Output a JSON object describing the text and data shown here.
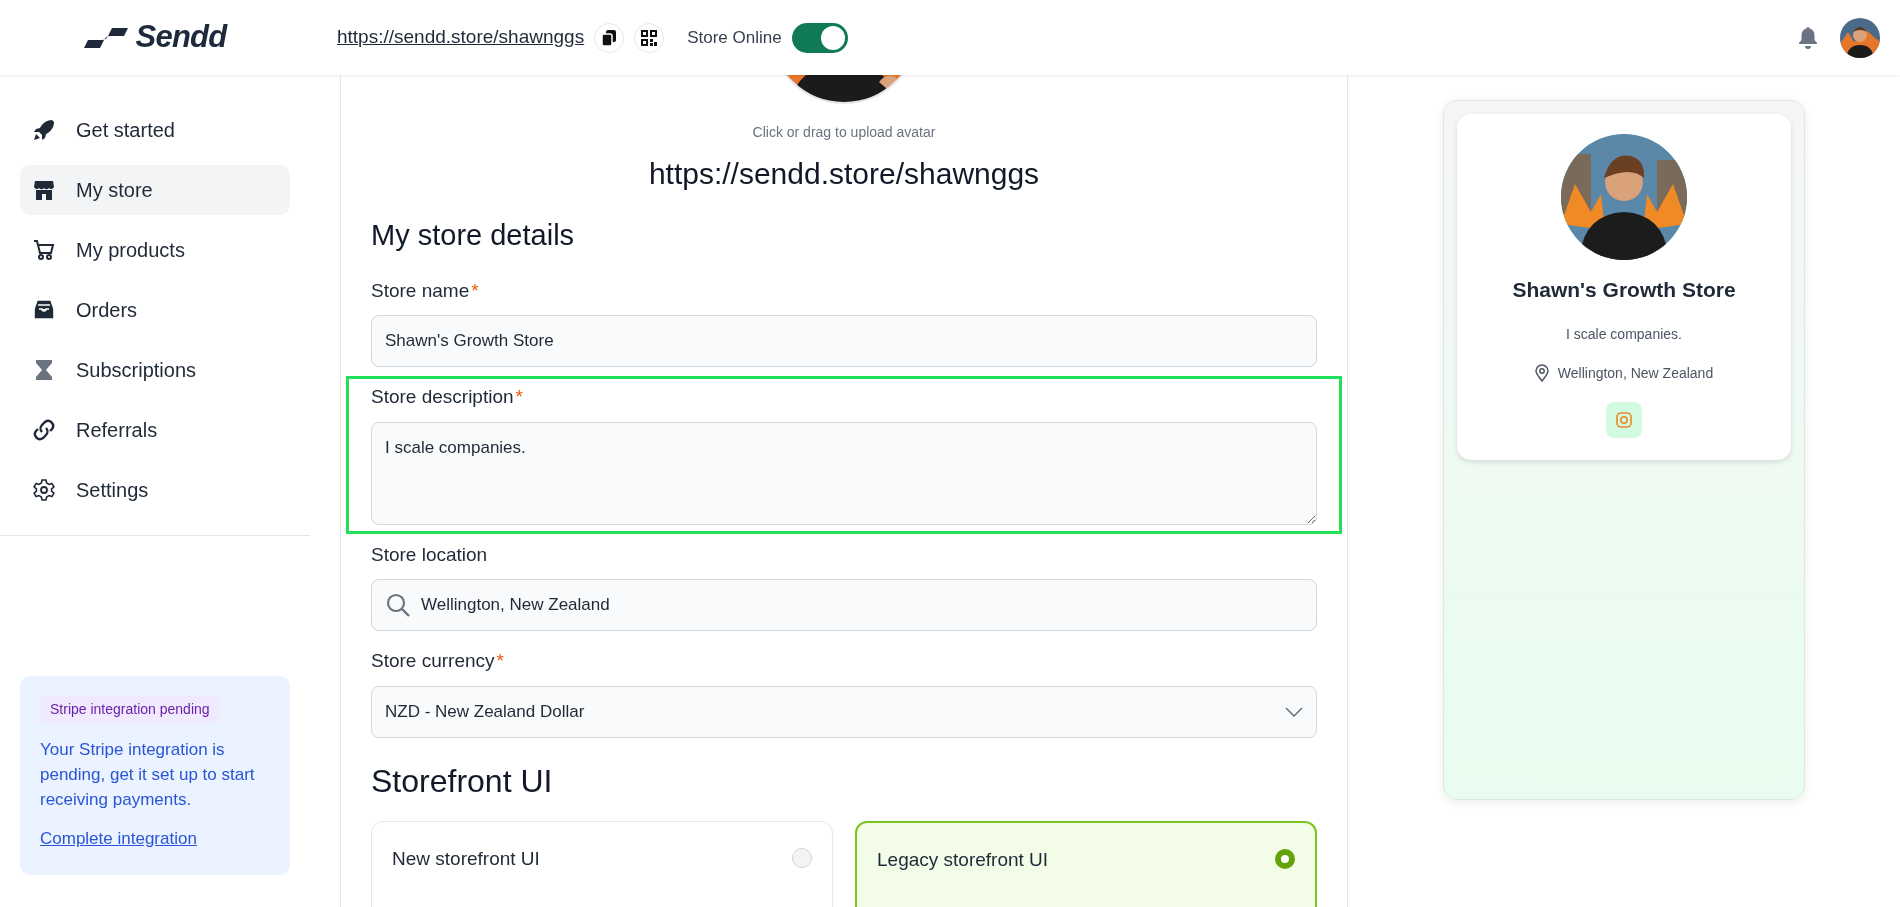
{
  "header": {
    "logo_text": "Sendd",
    "store_url": "https://sendd.store/shawnggs",
    "toggle": {
      "label": "Store Online",
      "on": true
    }
  },
  "sidebar": {
    "items": [
      {
        "label": "Get started",
        "selected": false
      },
      {
        "label": "My store",
        "selected": true
      },
      {
        "label": "My products",
        "selected": false
      },
      {
        "label": "Orders",
        "selected": false
      },
      {
        "label": "Subscriptions",
        "selected": false
      },
      {
        "label": "Referrals",
        "selected": false
      },
      {
        "label": "Settings",
        "selected": false
      }
    ],
    "notice": {
      "badge": "Stripe integration pending",
      "text": "Your Stripe integration is pending, get it set up to start receiving payments.",
      "link": "Complete integration"
    }
  },
  "editor": {
    "avatar_hint": "Click or drag to upload avatar",
    "store_url": "https://sendd.store/shawnggs",
    "section_title": "My store details",
    "fields": [
      {
        "kind": "text",
        "label": "Store name",
        "required_mark": "*",
        "value": "Shawn's Growth Store",
        "highlighted": false
      },
      {
        "kind": "textarea",
        "label": "Store description",
        "required_mark": "*",
        "value": "I scale companies.",
        "highlighted": true
      },
      {
        "kind": "search",
        "label": "Store location",
        "value": "Wellington, New Zealand",
        "highlighted": false
      },
      {
        "kind": "select",
        "label": "Store currency",
        "required_mark": "*",
        "value": "NZD - New Zealand Dollar",
        "highlighted": false
      }
    ],
    "storefront_title": "Storefront UI",
    "storefront_options": [
      {
        "label": "New storefront UI",
        "selected": false
      },
      {
        "label": "Legacy storefront UI",
        "selected": true
      }
    ]
  },
  "preview": {
    "name": "Shawn's Growth Store",
    "description": "I scale companies.",
    "location": "Wellington, New Zealand"
  }
}
